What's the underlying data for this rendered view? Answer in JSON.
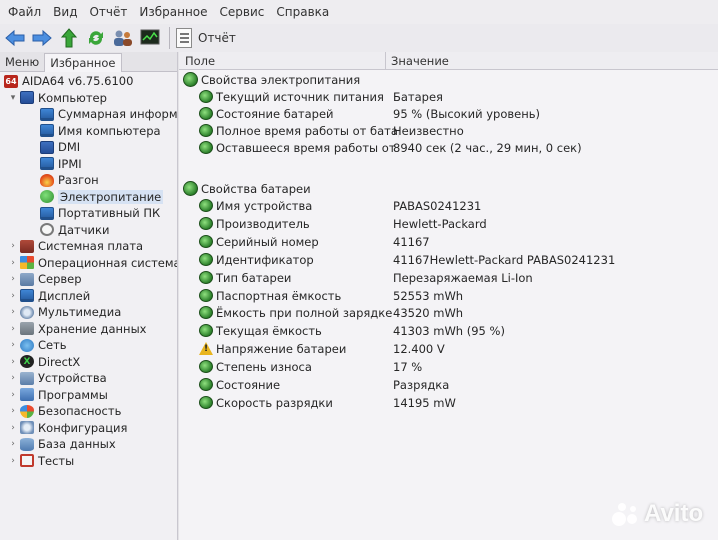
{
  "menu": [
    "Файл",
    "Вид",
    "Отчёт",
    "Избранное",
    "Сервис",
    "Справка"
  ],
  "toolbar": {
    "report_label": "Отчёт"
  },
  "left": {
    "tabs": [
      "Меню",
      "Избранное"
    ],
    "tree": [
      {
        "label": "AIDA64 v6.75.6100",
        "icon": "aida64-icon",
        "level": 0,
        "arrow": ""
      },
      {
        "label": "Компьютер",
        "icon": "computer-icon",
        "level": 1,
        "arrow": "▾"
      },
      {
        "label": "Суммарная информация",
        "icon": "monitor-icon",
        "level": 2,
        "arrow": ""
      },
      {
        "label": "Имя компьютера",
        "icon": "monitor-icon",
        "level": 2,
        "arrow": ""
      },
      {
        "label": "DMI",
        "icon": "computer-icon",
        "level": 2,
        "arrow": ""
      },
      {
        "label": "IPMI",
        "icon": "monitor-icon",
        "level": 2,
        "arrow": ""
      },
      {
        "label": "Разгон",
        "icon": "fire-icon",
        "level": 2,
        "arrow": ""
      },
      {
        "label": "Электропитание",
        "icon": "power-icon",
        "level": 2,
        "arrow": "",
        "selected": true
      },
      {
        "label": "Портативный ПК",
        "icon": "laptop-icon",
        "level": 2,
        "arrow": ""
      },
      {
        "label": "Датчики",
        "icon": "sensor-icon",
        "level": 2,
        "arrow": ""
      },
      {
        "label": "Системная плата",
        "icon": "motherboard-icon",
        "level": 1,
        "arrow": "›"
      },
      {
        "label": "Операционная система",
        "icon": "windows-icon",
        "level": 1,
        "arrow": "›"
      },
      {
        "label": "Сервер",
        "icon": "server-icon",
        "level": 1,
        "arrow": "›"
      },
      {
        "label": "Дисплей",
        "icon": "display-icon",
        "level": 1,
        "arrow": "›"
      },
      {
        "label": "Мультимедиа",
        "icon": "multimedia-icon",
        "level": 1,
        "arrow": "›"
      },
      {
        "label": "Хранение данных",
        "icon": "storage-icon",
        "level": 1,
        "arrow": "›"
      },
      {
        "label": "Сеть",
        "icon": "network-icon",
        "level": 1,
        "arrow": "›"
      },
      {
        "label": "DirectX",
        "icon": "directx-icon",
        "level": 1,
        "arrow": "›"
      },
      {
        "label": "Устройства",
        "icon": "devices-icon",
        "level": 1,
        "arrow": "›"
      },
      {
        "label": "Программы",
        "icon": "programs-icon",
        "level": 1,
        "arrow": "›"
      },
      {
        "label": "Безопасность",
        "icon": "security-icon",
        "level": 1,
        "arrow": "›"
      },
      {
        "label": "Конфигурация",
        "icon": "config-icon",
        "level": 1,
        "arrow": "›"
      },
      {
        "label": "База данных",
        "icon": "database-icon",
        "level": 1,
        "arrow": "›"
      },
      {
        "label": "Тесты",
        "icon": "tests-icon",
        "level": 1,
        "arrow": "›"
      }
    ]
  },
  "right": {
    "header": {
      "field": "Поле",
      "value": "Значение"
    },
    "rows": [
      {
        "type": "group",
        "field": "Свойства электропитания",
        "value": ""
      },
      {
        "type": "item",
        "icon": "power-icon",
        "field": "Текущий источник питания",
        "value": "Батарея"
      },
      {
        "type": "item",
        "icon": "power-icon",
        "field": "Состояние батарей",
        "value": "95 % (Высокий уровень)"
      },
      {
        "type": "item",
        "icon": "power-icon",
        "field": "Полное время работы от батареи",
        "value": "Неизвестно"
      },
      {
        "type": "item",
        "icon": "power-icon",
        "field": "Оставшееся время работы от батареи",
        "value": "8940 сек (2 час., 29 мин, 0 сек)"
      },
      {
        "type": "blank",
        "field": "",
        "value": ""
      },
      {
        "type": "group",
        "field": "Свойства батареи",
        "value": ""
      },
      {
        "type": "item",
        "icon": "power-icon",
        "field": "Имя устройства",
        "value": "PABAS0241231"
      },
      {
        "type": "item",
        "icon": "power-icon",
        "field": "Производитель",
        "value": "Hewlett-Packard"
      },
      {
        "type": "item",
        "icon": "power-icon",
        "field": "Серийный номер",
        "value": "41167"
      },
      {
        "type": "item",
        "icon": "power-icon",
        "field": "Идентификатор",
        "value": "41167Hewlett-Packard PABAS0241231"
      },
      {
        "type": "item",
        "icon": "power-icon",
        "field": "Тип батареи",
        "value": "Перезаряжаемая Li-Ion"
      },
      {
        "type": "item",
        "icon": "power-icon",
        "field": "Паспортная ёмкость",
        "value": "52553 mWh"
      },
      {
        "type": "item",
        "icon": "power-icon",
        "field": "Ёмкость при полной зарядке",
        "value": "43520 mWh"
      },
      {
        "type": "item",
        "icon": "power-icon",
        "field": "Текущая ёмкость",
        "value": "41303 mWh  (95 %)"
      },
      {
        "type": "item",
        "icon": "warning-icon",
        "field": "Напряжение батареи",
        "value": "12.400 V"
      },
      {
        "type": "item",
        "icon": "power-icon",
        "field": "Степень износа",
        "value": "17 %"
      },
      {
        "type": "item",
        "icon": "power-icon",
        "field": "Состояние",
        "value": "Разрядка"
      },
      {
        "type": "item",
        "icon": "power-icon",
        "field": "Скорость разрядки",
        "value": "14195 mW"
      }
    ]
  },
  "watermark": "Avito"
}
